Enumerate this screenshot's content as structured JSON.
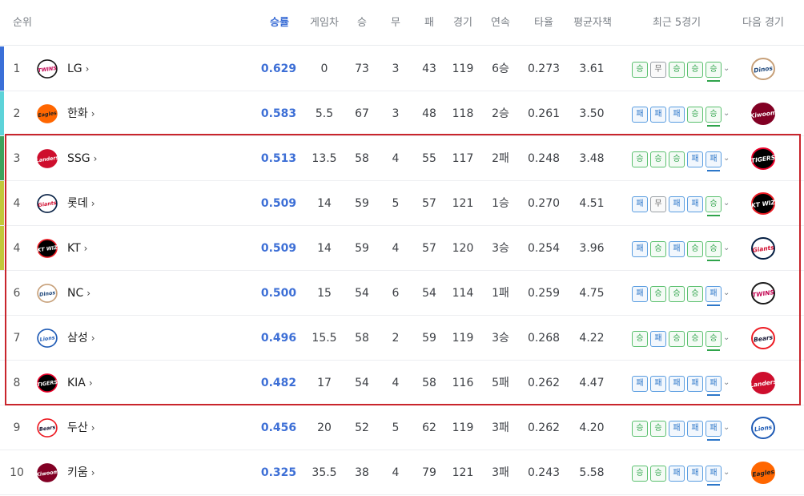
{
  "headers": {
    "rank": "순위",
    "pct": "승률",
    "gb": "게임차",
    "win": "승",
    "draw": "무",
    "loss": "패",
    "games": "경기",
    "streak": "연속",
    "avg": "타율",
    "era": "평균자책",
    "recent5": "최근 5경기",
    "next": "다음 경기"
  },
  "rows": [
    {
      "rank": "1",
      "team": "LG",
      "pct": "0.629",
      "gb": "0",
      "w": "73",
      "d": "3",
      "l": "43",
      "g": "119",
      "streak": "6승",
      "avg": "0.273",
      "era": "3.61",
      "recent": [
        "승",
        "무",
        "승",
        "승",
        "승"
      ],
      "bar": "#3a6fd8",
      "logo": "twins",
      "next": "dinos"
    },
    {
      "rank": "2",
      "team": "한화",
      "pct": "0.583",
      "gb": "5.5",
      "w": "67",
      "d": "3",
      "l": "48",
      "g": "118",
      "streak": "2승",
      "avg": "0.261",
      "era": "3.50",
      "recent": [
        "패",
        "패",
        "패",
        "승",
        "승"
      ],
      "bar": "#5dd3d9",
      "logo": "eagles",
      "next": "kiwoom"
    },
    {
      "rank": "3",
      "team": "SSG",
      "pct": "0.513",
      "gb": "13.5",
      "w": "58",
      "d": "4",
      "l": "55",
      "g": "117",
      "streak": "2패",
      "avg": "0.248",
      "era": "3.48",
      "recent": [
        "승",
        "승",
        "승",
        "패",
        "패"
      ],
      "bar": "#3da35d",
      "logo": "landers",
      "next": "tigers"
    },
    {
      "rank": "4",
      "team": "롯데",
      "pct": "0.509",
      "gb": "14",
      "w": "59",
      "d": "5",
      "l": "57",
      "g": "121",
      "streak": "1승",
      "avg": "0.270",
      "era": "4.51",
      "recent": [
        "패",
        "무",
        "패",
        "패",
        "승"
      ],
      "bar": "#c2c83a",
      "logo": "giants",
      "next": "ktwiz"
    },
    {
      "rank": "4",
      "team": "KT",
      "pct": "0.509",
      "gb": "14",
      "w": "59",
      "d": "4",
      "l": "57",
      "g": "120",
      "streak": "3승",
      "avg": "0.254",
      "era": "3.96",
      "recent": [
        "패",
        "승",
        "패",
        "승",
        "승"
      ],
      "bar": "#c2c83a",
      "logo": "ktwiz",
      "next": "giants"
    },
    {
      "rank": "6",
      "team": "NC",
      "pct": "0.500",
      "gb": "15",
      "w": "54",
      "d": "6",
      "l": "54",
      "g": "114",
      "streak": "1패",
      "avg": "0.259",
      "era": "4.75",
      "recent": [
        "패",
        "승",
        "승",
        "승",
        "패"
      ],
      "bar": "",
      "logo": "dinos",
      "next": "twins"
    },
    {
      "rank": "7",
      "team": "삼성",
      "pct": "0.496",
      "gb": "15.5",
      "w": "58",
      "d": "2",
      "l": "59",
      "g": "119",
      "streak": "3승",
      "avg": "0.268",
      "era": "4.22",
      "recent": [
        "승",
        "패",
        "승",
        "승",
        "승"
      ],
      "bar": "",
      "logo": "lions",
      "next": "bears"
    },
    {
      "rank": "8",
      "team": "KIA",
      "pct": "0.482",
      "gb": "17",
      "w": "54",
      "d": "4",
      "l": "58",
      "g": "116",
      "streak": "5패",
      "avg": "0.262",
      "era": "4.47",
      "recent": [
        "패",
        "패",
        "패",
        "패",
        "패"
      ],
      "bar": "",
      "logo": "tigers",
      "next": "landers"
    },
    {
      "rank": "9",
      "team": "두산",
      "pct": "0.456",
      "gb": "20",
      "w": "52",
      "d": "5",
      "l": "62",
      "g": "119",
      "streak": "3패",
      "avg": "0.262",
      "era": "4.20",
      "recent": [
        "승",
        "승",
        "패",
        "패",
        "패"
      ],
      "bar": "",
      "logo": "bears",
      "next": "lions"
    },
    {
      "rank": "10",
      "team": "키움",
      "pct": "0.325",
      "gb": "35.5",
      "w": "38",
      "d": "4",
      "l": "79",
      "g": "121",
      "streak": "3패",
      "avg": "0.243",
      "era": "5.58",
      "recent": [
        "승",
        "승",
        "패",
        "패",
        "패"
      ],
      "bar": "",
      "logo": "kiwoom",
      "next": "eagles"
    }
  ],
  "logos": {
    "twins": {
      "text": "TWINS",
      "fg": "#c30452",
      "bg": "#ffffff",
      "ring": "#1a1a1a"
    },
    "eagles": {
      "text": "Eagles",
      "fg": "#222222",
      "bg": "#ff6600",
      "ring": "#ff6600"
    },
    "landers": {
      "text": "Landers",
      "fg": "#ffffff",
      "bg": "#ce0e2d",
      "ring": "#ce0e2d"
    },
    "giants": {
      "text": "Giants",
      "fg": "#d00f31",
      "bg": "#ffffff",
      "ring": "#041e42"
    },
    "ktwiz": {
      "text": "KT WIZ",
      "fg": "#ffffff",
      "bg": "#000000",
      "ring": "#eb1c24"
    },
    "dinos": {
      "text": "Dinos",
      "fg": "#1d467a",
      "bg": "#ffffff",
      "ring": "#c7a079"
    },
    "lions": {
      "text": "Lions",
      "fg": "#1f5bb5",
      "bg": "#ffffff",
      "ring": "#1f5bb5"
    },
    "tigers": {
      "text": "TIGERS",
      "fg": "#ffffff",
      "bg": "#000000",
      "ring": "#ea0029"
    },
    "bears": {
      "text": "Bears",
      "fg": "#131230",
      "bg": "#ffffff",
      "ring": "#ed1c24"
    },
    "kiwoom": {
      "text": "Kiwoom",
      "fg": "#ffffff",
      "bg": "#820024",
      "ring": "#820024"
    }
  },
  "win_label": "승",
  "loss_label": "패",
  "draw_label": "무",
  "arrow_glyph": "›",
  "chevron_glyph": "⌄"
}
